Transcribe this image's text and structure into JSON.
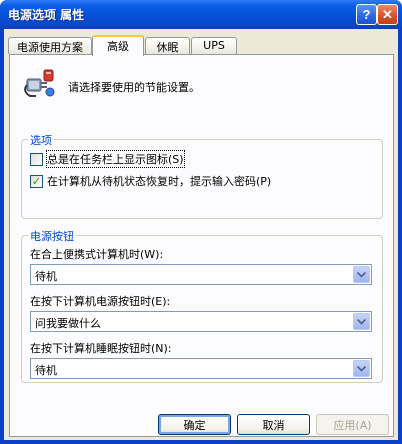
{
  "window": {
    "title": "电源选项 属性",
    "help_glyph": "?",
    "close_glyph": "✕"
  },
  "tabs": [
    {
      "label": "电源使用方案",
      "active": false
    },
    {
      "label": "高级",
      "active": true
    },
    {
      "label": "休眠",
      "active": false
    },
    {
      "label": "UPS",
      "active": false
    }
  ],
  "header": {
    "icon": "power-plug-icon",
    "text": "请选择要使用的节能设置。"
  },
  "options_group": {
    "label": "选项",
    "items": [
      {
        "label": "总是在任务栏上显示图标(S)",
        "checked": false
      },
      {
        "label": "在计算机从待机状态恢复时，提示输入密码(P)",
        "checked": true
      }
    ]
  },
  "power_buttons_group": {
    "label": "电源按钮",
    "fields": [
      {
        "label": "在合上便携式计算机时(W):",
        "value": "待机"
      },
      {
        "label": "在按下计算机电源按钮时(E):",
        "value": "问我要做什么"
      },
      {
        "label": "在按下计算机睡眠按钮时(N):",
        "value": "待机"
      }
    ]
  },
  "buttons": {
    "ok": "确定",
    "cancel": "取消",
    "apply": "应用(A)"
  },
  "colors": {
    "accent": "#0046d5",
    "dialog_bg": "#ece9d8",
    "checkmark": "#21a121"
  }
}
